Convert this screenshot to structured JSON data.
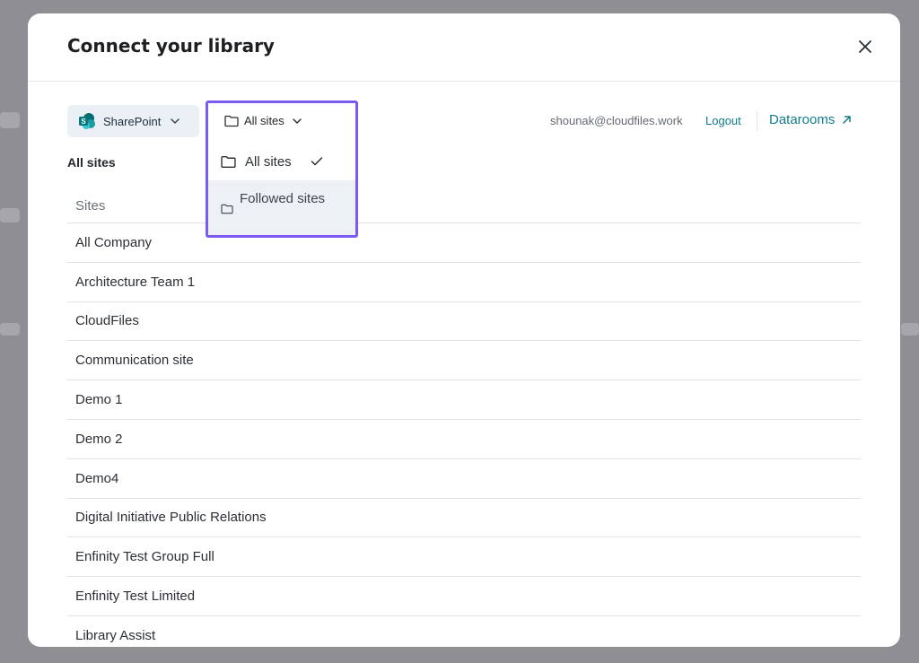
{
  "modal": {
    "title": "Connect your library"
  },
  "toolbar": {
    "source_label": "SharePoint",
    "user_email": "shounak@cloudfiles.work",
    "logout_label": "Logout",
    "datarooms_label": "Datarooms"
  },
  "dropdown": {
    "selected_label": "All sites",
    "options": [
      {
        "label": "All sites",
        "selected": true
      },
      {
        "label": "Followed sites",
        "selected": false
      }
    ]
  },
  "section_title": "All sites",
  "table": {
    "header": "Sites",
    "rows": [
      "All Company",
      "Architecture Team 1",
      "CloudFiles",
      "Communication site",
      "Demo 1",
      "Demo 2",
      "Demo4",
      "Digital Initiative Public Relations",
      "Enfinity Test Group Full",
      "Enfinity Test Limited",
      "Library Assist"
    ]
  },
  "colors": {
    "accent": "#137c8a",
    "highlight_border": "#7c5cf0",
    "sharepoint_brand": "#038387"
  },
  "icons": [
    "close-icon",
    "sharepoint-icon",
    "chevron-down-icon",
    "folder-icon",
    "check-icon",
    "external-link-icon"
  ]
}
